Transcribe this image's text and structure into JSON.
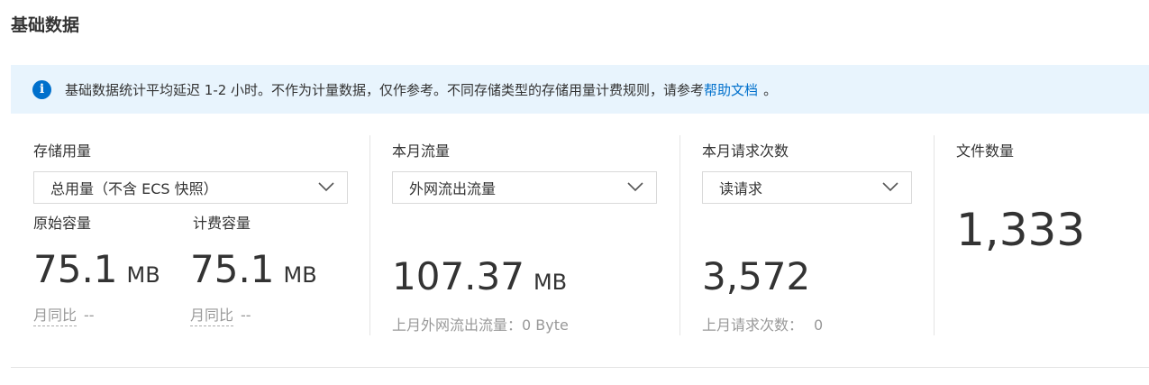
{
  "page": {
    "title": "基础数据"
  },
  "banner": {
    "icon": "info-icon",
    "text": "基础数据统计平均延迟 1-2 小时。不作为计量数据，仅作参考。不同存储类型的存储用量计费规则，请参考",
    "link_text": "帮助文档",
    "suffix": "。",
    "icon_color": "#0070cc",
    "background": "#e8f4fd"
  },
  "storage": {
    "title": "存储用量",
    "select_value": "总用量（不含 ECS 快照）",
    "raw": {
      "label": "原始容量",
      "value": "75.1",
      "unit": "MB",
      "compare_label": "月同比",
      "compare_value": "--"
    },
    "billed": {
      "label": "计费容量",
      "value": "75.1",
      "unit": "MB",
      "compare_label": "月同比",
      "compare_value": "--"
    }
  },
  "traffic": {
    "title": "本月流量",
    "select_value": "外网流出流量",
    "value": "107.37",
    "unit": "MB",
    "footnote": "上月外网流出流量：0 Byte"
  },
  "requests": {
    "title": "本月请求次数",
    "select_value": "读请求",
    "value": "3,572",
    "footnote_label": "上月请求次数：",
    "footnote_value": "0"
  },
  "files": {
    "title": "文件数量",
    "value": "1,333"
  }
}
